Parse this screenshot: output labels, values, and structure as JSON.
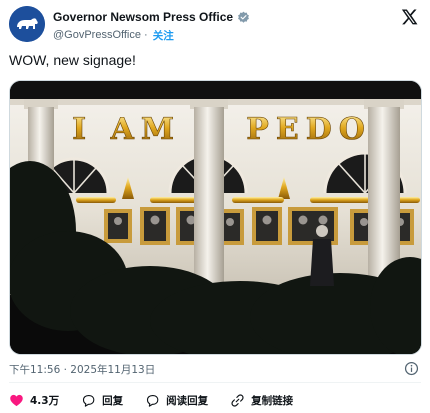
{
  "author": {
    "display_name": "Governor Newsom Press Office",
    "handle": "@GovPressOffice",
    "handle_separator": " · ",
    "follow_label": "关注"
  },
  "tweet": {
    "text": "WOW, new signage!"
  },
  "media": {
    "sign_text": "I AM A PEDO"
  },
  "meta": {
    "timestamp": "下午11:56 · 2025年11月13日"
  },
  "actions": {
    "like_count": "4.3万",
    "reply_label": "回复",
    "read_replies_label": "阅读回复",
    "copy_link_label": "复制链接"
  },
  "colors": {
    "accent": "#1d9bf0",
    "like": "#f91880",
    "verified": "#829aab",
    "avatar_bg": "#1d4f9c"
  }
}
